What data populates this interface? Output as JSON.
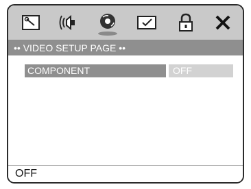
{
  "tabs": [
    {
      "name": "general-setup-tab",
      "icon": "wrench-icon"
    },
    {
      "name": "audio-setup-tab",
      "icon": "speaker-icon"
    },
    {
      "name": "video-setup-tab",
      "icon": "video-disc-icon",
      "active": true
    },
    {
      "name": "preference-tab",
      "icon": "checkbox-icon"
    },
    {
      "name": "password-tab",
      "icon": "lock-icon"
    },
    {
      "name": "exit-tab",
      "icon": "close-icon"
    }
  ],
  "page_title": "•• VIDEO SETUP PAGE ••",
  "option": {
    "label": "COMPONENT",
    "value": "OFF"
  },
  "status_text": "OFF",
  "colors": {
    "icon_bar": "#c9c9c9",
    "title_bar": "#8f8f8f",
    "selected_label": "#8f8f8f",
    "value_box": "#d2d2d2"
  }
}
